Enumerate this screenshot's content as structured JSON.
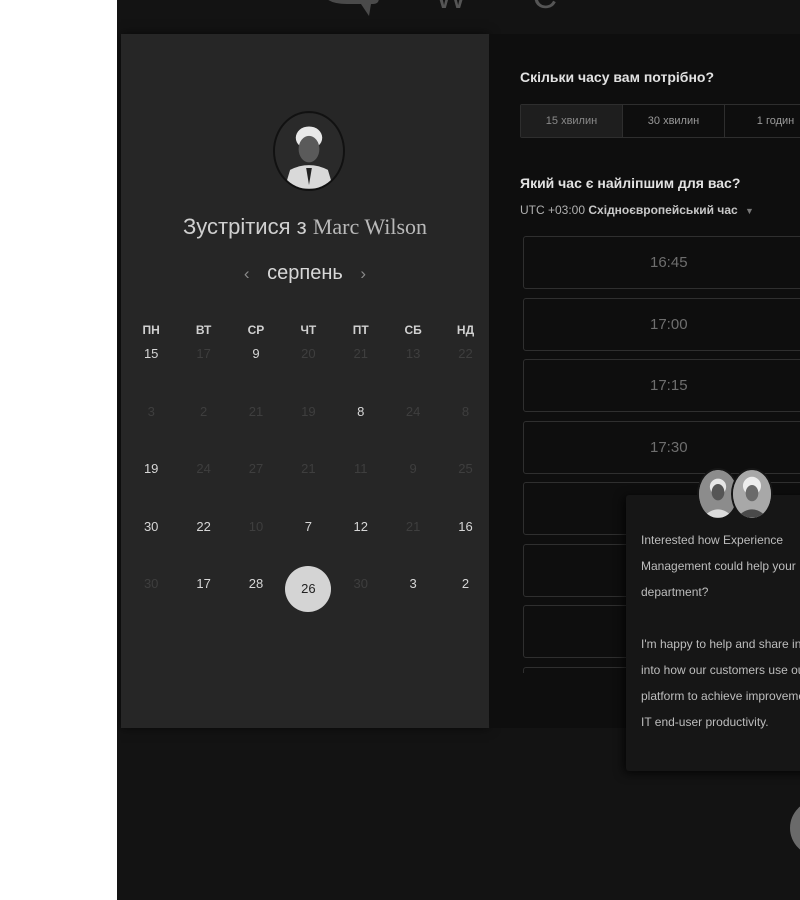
{
  "header": {
    "logo_icon": "chat-bubble-logo",
    "logo_text": "W C"
  },
  "host": {
    "avatar_icon": "host-avatar",
    "title_prefix": "Зустрітися з",
    "name": "Marc Wilson"
  },
  "calendar": {
    "month": "серпень",
    "prev_icon": "chevron-left-icon",
    "next_icon": "chevron-right-icon",
    "weekdays": [
      "ПН",
      "ВТ",
      "СР",
      "ЧТ",
      "ПТ",
      "СБ",
      "НД"
    ],
    "days": [
      {
        "label": "15",
        "state": "available"
      },
      {
        "label": "17",
        "state": "unavailable"
      },
      {
        "label": "9",
        "state": "available"
      },
      {
        "label": "20",
        "state": "unavailable"
      },
      {
        "label": "21",
        "state": "unavailable"
      },
      {
        "label": "13",
        "state": "unavailable"
      },
      {
        "label": "22",
        "state": "unavailable"
      },
      {
        "label": "3",
        "state": "unavailable"
      },
      {
        "label": "2",
        "state": "unavailable"
      },
      {
        "label": "21",
        "state": "unavailable"
      },
      {
        "label": "19",
        "state": "unavailable"
      },
      {
        "label": "8",
        "state": "available"
      },
      {
        "label": "24",
        "state": "unavailable"
      },
      {
        "label": "8",
        "state": "unavailable"
      },
      {
        "label": "19",
        "state": "available"
      },
      {
        "label": "24",
        "state": "unavailable"
      },
      {
        "label": "27",
        "state": "unavailable"
      },
      {
        "label": "21",
        "state": "unavailable"
      },
      {
        "label": "11",
        "state": "unavailable"
      },
      {
        "label": "9",
        "state": "unavailable"
      },
      {
        "label": "25",
        "state": "unavailable"
      },
      {
        "label": "30",
        "state": "available"
      },
      {
        "label": "22",
        "state": "available"
      },
      {
        "label": "10",
        "state": "unavailable"
      },
      {
        "label": "7",
        "state": "available"
      },
      {
        "label": "12",
        "state": "available"
      },
      {
        "label": "21",
        "state": "unavailable"
      },
      {
        "label": "16",
        "state": "available"
      },
      {
        "label": "30",
        "state": "unavailable"
      },
      {
        "label": "17",
        "state": "available"
      },
      {
        "label": "28",
        "state": "available"
      },
      {
        "label": "26",
        "state": "selected"
      },
      {
        "label": "30",
        "state": "unavailable"
      },
      {
        "label": "3",
        "state": "available"
      },
      {
        "label": "2",
        "state": "available"
      }
    ]
  },
  "booking": {
    "duration_question": "Скільки часу вам потрібно?",
    "durations": [
      {
        "label": "15 хвилин",
        "active": true
      },
      {
        "label": "30 хвилин",
        "active": false
      },
      {
        "label": "1 годин",
        "active": false
      }
    ],
    "time_question": "Який час є найліпшим для вас?",
    "timezone_offset": "UTC +03:00",
    "timezone_name": "Східноєвропейський час",
    "timezone_caret_icon": "caret-down-icon",
    "slots": [
      "16:45",
      "17:00",
      "17:15",
      "17:30",
      "",
      "",
      "",
      ""
    ]
  },
  "chat": {
    "avatars": [
      "agent-avatar-1",
      "agent-avatar-2"
    ],
    "message_1": "Interested how Experience Management could help your IT department?",
    "message_2": "I'm happy to help and share insight into how our customers use our platform to achieve improvement in IT end-user productivity.",
    "launcher_icon": "chat-launcher-icon"
  }
}
